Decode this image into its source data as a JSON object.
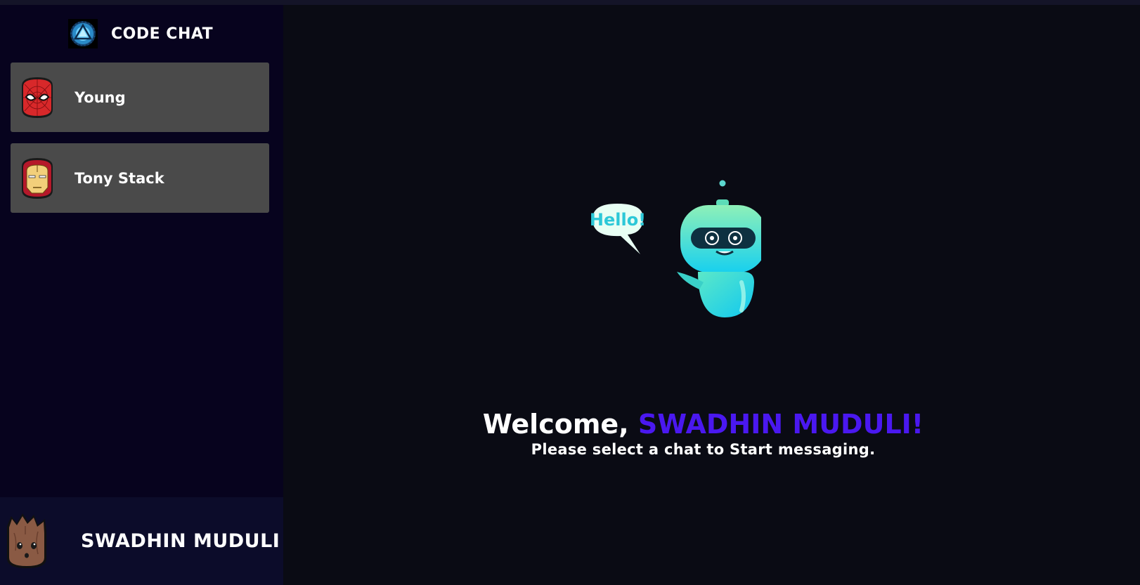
{
  "app": {
    "title": "CODE CHAT",
    "logo_icon": "arc-reactor-icon"
  },
  "sidebar": {
    "chats": [
      {
        "name": "Young",
        "avatar_icon": "spiderman-avatar"
      },
      {
        "name": "Tony Stack",
        "avatar_icon": "ironman-avatar"
      }
    ]
  },
  "current_user": {
    "name": "SWADHIN MUDULI",
    "avatar_icon": "groot-avatar"
  },
  "welcome": {
    "prefix": "Welcome, ",
    "name": "SWADHIN MUDULI!",
    "subtitle": "Please select a chat to Start messaging.",
    "illustration_icon": "robot-hello-icon",
    "bubble_text": "Hello!"
  },
  "colors": {
    "sidebar_bg": "#07031e",
    "main_bg": "#0a0b14",
    "chat_item_bg": "#4a4a4a",
    "accent": "#4a18f0",
    "footer_bg": "#0c0c2a"
  }
}
